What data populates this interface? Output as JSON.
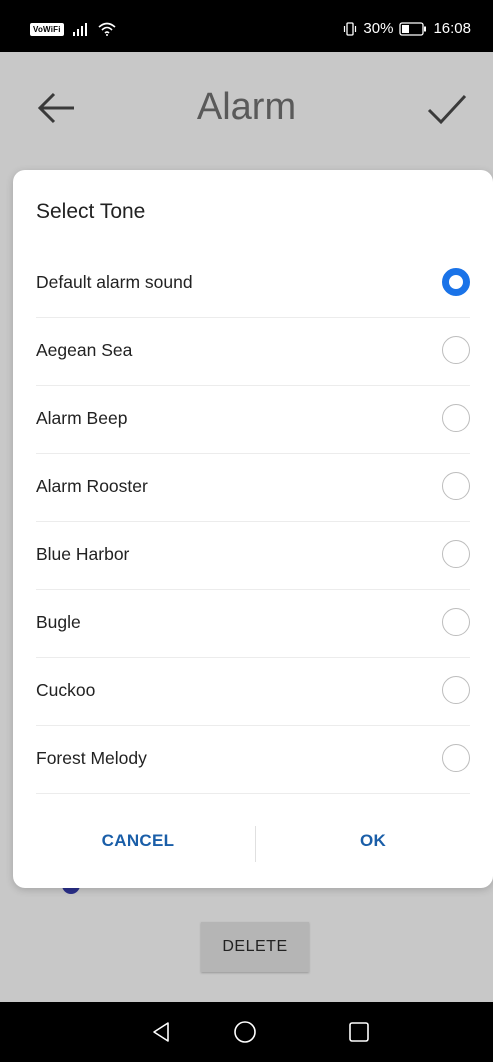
{
  "status_bar": {
    "carrier_badge": "VoWiFi",
    "battery": "30%",
    "time": "16:08"
  },
  "app_bar": {
    "title": "Alarm"
  },
  "dialog": {
    "title": "Select Tone",
    "selected_index": 0,
    "tones": [
      {
        "label": "Default alarm sound",
        "selected": true
      },
      {
        "label": "Aegean Sea",
        "selected": false
      },
      {
        "label": "Alarm Beep",
        "selected": false
      },
      {
        "label": "Alarm Rooster",
        "selected": false
      },
      {
        "label": "Blue Harbor",
        "selected": false
      },
      {
        "label": "Bugle",
        "selected": false
      },
      {
        "label": "Cuckoo",
        "selected": false
      },
      {
        "label": "Forest Melody",
        "selected": false
      }
    ],
    "cancel_label": "CANCEL",
    "ok_label": "OK",
    "accent_color": "#1a73e8"
  },
  "background": {
    "delete_label": "DELETE"
  },
  "icons": {
    "back": "arrow-left-icon",
    "confirm": "check-icon",
    "nav_back": "triangle-back-icon",
    "nav_home": "circle-home-icon",
    "nav_recent": "square-recent-icon"
  }
}
